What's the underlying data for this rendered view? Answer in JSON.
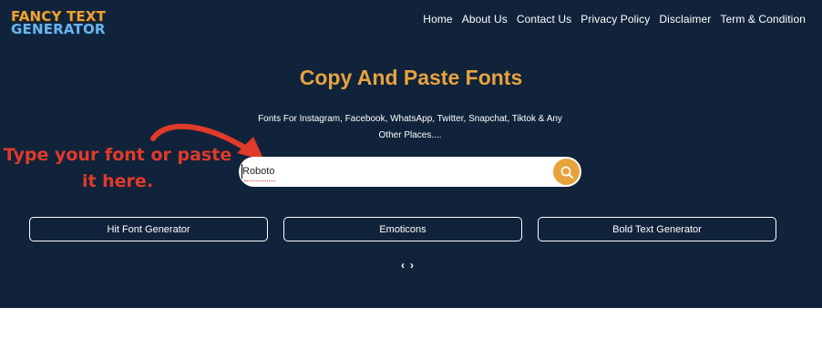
{
  "header": {
    "logo_line1": "FANCY TEXT",
    "logo_line2": "GENERATOR",
    "nav": [
      "Home",
      "About Us",
      "Contact Us",
      "Privacy Policy",
      "Disclaimer",
      "Term & Condition"
    ]
  },
  "hero": {
    "title": "Copy And Paste Fonts",
    "subtitle": "Fonts For Instagram, Facebook, WhatsApp, Twitter, Snapchat, Tiktok & Any Other Places....",
    "callout": "Type your font or paste it here."
  },
  "search": {
    "value": "Roboto",
    "icon": "search-icon"
  },
  "links": [
    "Hit Font Generator",
    "Emoticons",
    "Bold Text Generator"
  ],
  "pager": {
    "prev": "‹",
    "next": "›"
  },
  "colors": {
    "hero_bg": "#10233a",
    "accent": "#e8a33d",
    "callout": "#e03a2a"
  }
}
